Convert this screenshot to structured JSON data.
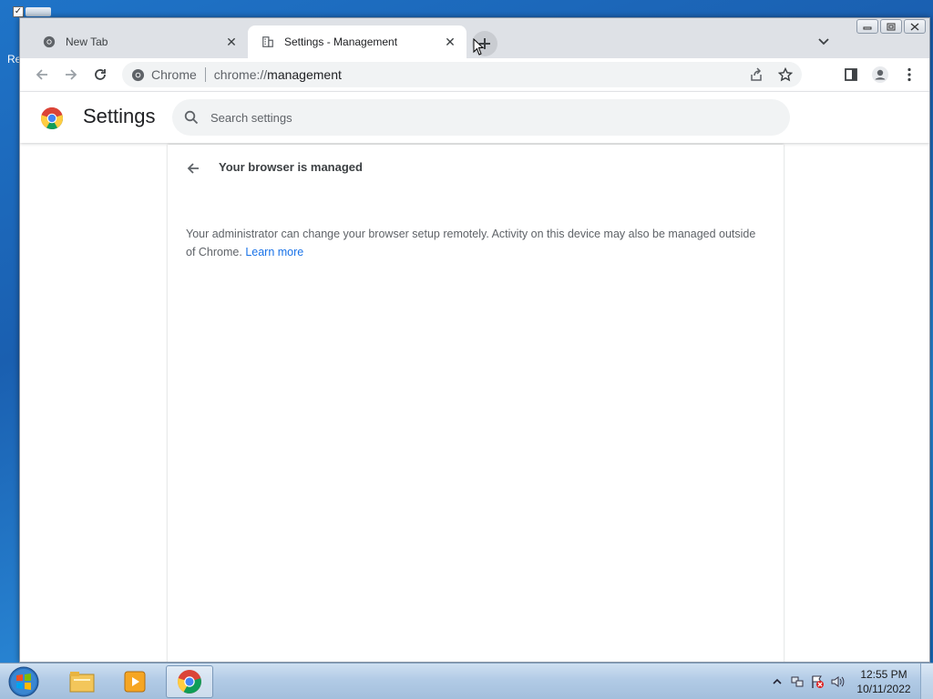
{
  "desktop": {
    "label_fragment": "Re"
  },
  "tabs": [
    {
      "title": "New Tab",
      "close": "✕"
    },
    {
      "title": "Settings - Management",
      "close": "✕"
    }
  ],
  "toolbar": {
    "site_chip": "Chrome",
    "url_scheme": "chrome://",
    "url_host": "management"
  },
  "settings": {
    "title": "Settings",
    "search_placeholder": "Search settings"
  },
  "management": {
    "heading": "Your browser is managed",
    "description": "Your administrator can change your browser setup remotely. Activity on this device may also be managed outside of Chrome.",
    "learn_more": "Learn more"
  },
  "taskbar": {
    "time": "12:55 PM",
    "date": "10/11/2022"
  },
  "colors": {
    "link": "#1a73e8",
    "tab_strip": "#dee1e6",
    "omnibox": "#f1f3f4"
  }
}
